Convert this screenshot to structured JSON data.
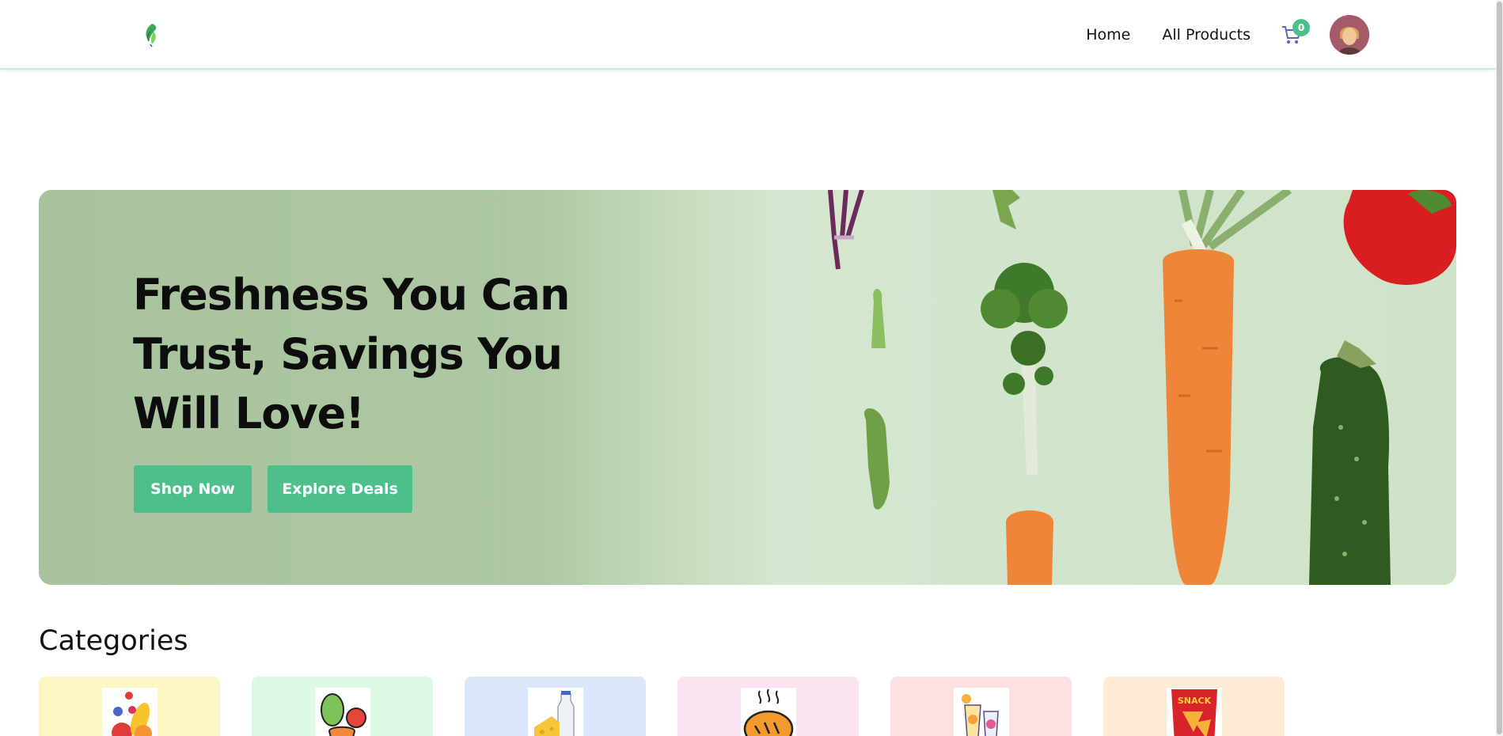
{
  "navbar": {
    "logo_icon": "leaf-icon",
    "links": [
      {
        "label": "Home"
      },
      {
        "label": "All Products"
      }
    ],
    "cart": {
      "icon": "cart-icon",
      "count": "0"
    },
    "avatar_icon": "user-avatar"
  },
  "hero": {
    "title": "Freshness You Can Trust, Savings You Will Love!",
    "buttons": {
      "shop_now": "Shop Now",
      "explore_deals": "Explore Deals"
    }
  },
  "categories": {
    "title": "Categories",
    "items": [
      {
        "icon": "fruits-icon",
        "bg": "#fdf6c3"
      },
      {
        "icon": "vegetables-icon",
        "bg": "#dcf9e6"
      },
      {
        "icon": "dairy-icon",
        "bg": "#dbe7fb"
      },
      {
        "icon": "bakery-icon",
        "bg": "#fbe4f1"
      },
      {
        "icon": "drinks-icon",
        "bg": "#fde0e2"
      },
      {
        "icon": "snacks-icon",
        "bg": "#fdebd6"
      }
    ],
    "snack_label": "SNACK"
  },
  "colors": {
    "accent": "#4cbf8a",
    "hero_bg": "#cde3c6"
  }
}
